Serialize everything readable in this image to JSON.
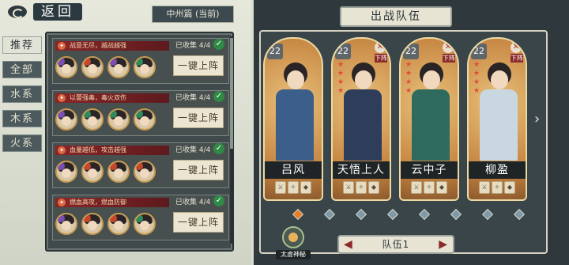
{
  "header": {
    "back_label": "返回",
    "chapter": "中州篇 (当前)"
  },
  "tabs": [
    "推荐",
    "全部",
    "水系",
    "木系",
    "火系"
  ],
  "groups": [
    {
      "title": "战意无尽，越战越强",
      "count": "已收集 4/4",
      "button": "一键上阵"
    },
    {
      "title": "以蕾强毒，毒火双伤",
      "count": "已收集 4/4",
      "button": "一键上阵"
    },
    {
      "title": "血量越低，攻击越强",
      "count": "已收集 4/4",
      "button": "一键上阵"
    },
    {
      "title": "燃血高攻，燃血防御",
      "count": "已收集 4/4",
      "button": "一键上阵"
    }
  ],
  "right": {
    "title": "出战队伍",
    "remove_label": "下阵",
    "team_label": "队伍1",
    "skill_label": "太虚神秘",
    "cards": [
      {
        "level": "22",
        "name": "吕风",
        "stars": 0,
        "removable": false
      },
      {
        "level": "22",
        "name": "天悟上人",
        "stars": 4,
        "removable": true
      },
      {
        "level": "22",
        "name": "云中子",
        "stars": 4,
        "removable": true
      },
      {
        "level": "22",
        "name": "柳盈",
        "stars": 4,
        "removable": true
      }
    ]
  },
  "colors": {
    "accent": "#e67e22",
    "dark": "#2f383c",
    "red_banner": "#8a2528"
  },
  "icons": [
    "back-swirl-icon",
    "check-icon",
    "element-icon",
    "close-icon",
    "arrow-right-icon",
    "arrow-left-icon"
  ]
}
